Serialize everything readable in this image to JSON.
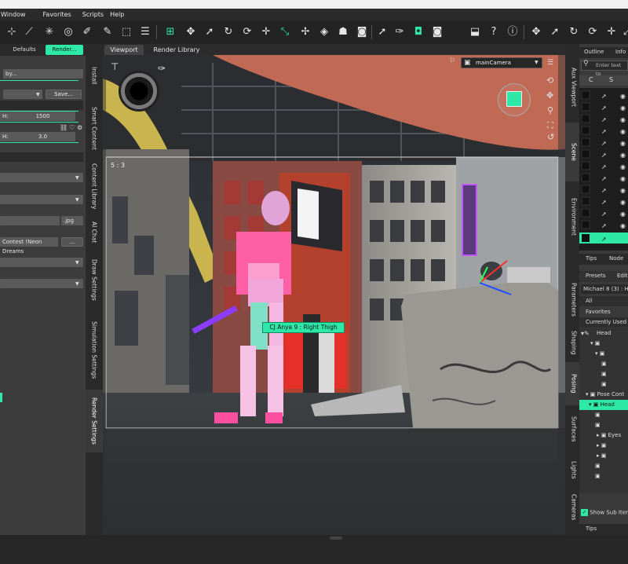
{
  "menu": {
    "items": [
      "Window",
      "Favorites",
      "Scripts",
      "Help"
    ]
  },
  "left_panel": {
    "tabs": {
      "defaults": "Defaults",
      "render": "Render..."
    },
    "field_by": "by...",
    "save_label": "Save...",
    "width_label": "H:",
    "width_value": "1500",
    "aspect_label": "H:",
    "aspect_value": "3.0",
    "format_value": ".jpg",
    "filename_value": "Contest !Neon Dreams",
    "more_btn": "..."
  },
  "side_tabs_left": [
    "Install",
    "Smart Content",
    "Content Library",
    "AI Chat",
    "Draw Settings",
    "Simulation Settings",
    "Render Settings"
  ],
  "viewport": {
    "tabs": [
      "Viewport",
      "Render Library"
    ],
    "aspect_ratio": "5 : 3",
    "camera": "mainCamera",
    "tooltip": "CJ Anya 9 : Right Thigh"
  },
  "side_tabs_right": [
    "Aux Viewport",
    "Scene",
    "Environment",
    "Parameters",
    "Shaping",
    "Posing",
    "Surfaces",
    "Lights",
    "Cameras"
  ],
  "right_panel": {
    "tabs_top": [
      "Outline",
      "Info"
    ],
    "search_placeholder": "Enter text to",
    "columns": [
      "C",
      "S"
    ],
    "tips_tabs": [
      "Tips",
      "Node"
    ],
    "presets_tabs": [
      "Presets",
      "Edit"
    ],
    "node_label": "Michael 8 (3) : He",
    "filter_items": [
      "All",
      "Favorites",
      "Currently Used"
    ],
    "tree": [
      "Head",
      "",
      "",
      "",
      "",
      "",
      "Pose Cont",
      "Head",
      "",
      "",
      "Eyes",
      "",
      "",
      "",
      ""
    ],
    "show_sub": "Show Sub Item",
    "tips_bottom": "Tips"
  },
  "colors": {
    "accent": "#2ee8a8",
    "bg": "#3a3a3a"
  }
}
